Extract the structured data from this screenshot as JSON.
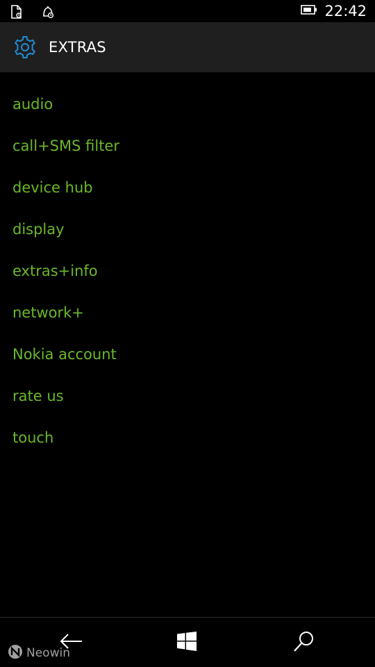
{
  "status_bar": {
    "time": "22:42",
    "icons": [
      "doc-notification-icon",
      "alarm-notification-icon",
      "battery-icon"
    ]
  },
  "header": {
    "icon": "gear-icon",
    "title": "EXTRAS"
  },
  "menu": {
    "items": [
      {
        "label": "audio"
      },
      {
        "label": "call+SMS filter"
      },
      {
        "label": "device hub"
      },
      {
        "label": "display"
      },
      {
        "label": "extras+info"
      },
      {
        "label": "network+"
      },
      {
        "label": "Nokia account"
      },
      {
        "label": "rate us"
      },
      {
        "label": "touch"
      }
    ]
  },
  "nav_bar": {
    "icons": [
      "back-arrow-icon",
      "windows-start-icon",
      "search-icon"
    ]
  },
  "watermark": {
    "text": "Neowin"
  },
  "colors": {
    "accent": "#6ab82a",
    "header_bg": "#1f1f1f",
    "gear_icon": "#1e8fd6",
    "background": "#000000",
    "text": "#ffffff"
  }
}
